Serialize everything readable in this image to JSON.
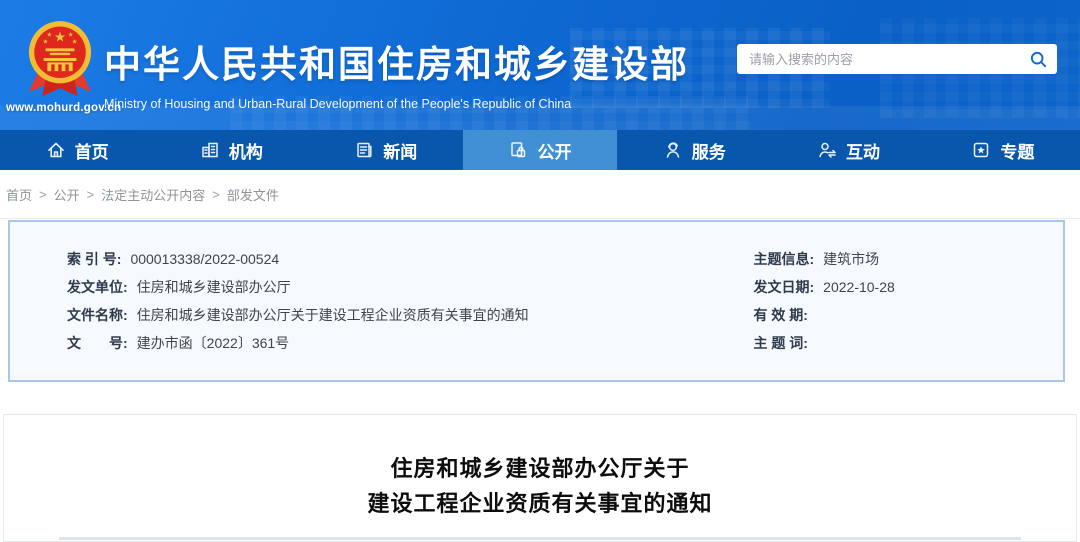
{
  "header": {
    "url_text": "www.mohurd.gov.cn",
    "site_name": "中华人民共和国住房和城乡建设部",
    "site_name_en": "Ministry of Housing and Urban-Rural Development of the People's Republic of China",
    "search": {
      "placeholder": "请输入搜索的内容",
      "icon": "search-icon"
    }
  },
  "nav": {
    "items": [
      {
        "label": "首页",
        "icon": "home-icon",
        "active": false
      },
      {
        "label": "机构",
        "icon": "organization-icon",
        "active": false
      },
      {
        "label": "新闻",
        "icon": "news-icon",
        "active": false
      },
      {
        "label": "公开",
        "icon": "disclosure-icon",
        "active": true
      },
      {
        "label": "服务",
        "icon": "service-icon",
        "active": false
      },
      {
        "label": "互动",
        "icon": "interaction-icon",
        "active": false
      },
      {
        "label": "专题",
        "icon": "topics-icon",
        "active": false
      }
    ]
  },
  "breadcrumb": {
    "separator": ">",
    "items": [
      "首页",
      "公开",
      "法定主动公开内容",
      "部发文件"
    ]
  },
  "doc_info": {
    "left": [
      {
        "label": "索 引 号:",
        "value": "000013338/2022-00524"
      },
      {
        "label": "发文单位:",
        "value": "住房和城乡建设部办公厅"
      },
      {
        "label": "文件名称:",
        "value": "住房和城乡建设部办公厅关于建设工程企业资质有关事宜的通知"
      },
      {
        "label": "文　　号:",
        "value": "建办市函〔2022〕361号"
      }
    ],
    "right": [
      {
        "label": "主题信息:",
        "value": "建筑市场"
      },
      {
        "label": "发文日期:",
        "value": "2022-10-28"
      },
      {
        "label": "有 效 期:",
        "value": ""
      },
      {
        "label": "主 题 词:",
        "value": ""
      }
    ]
  },
  "article": {
    "title_line1": "住房和城乡建设部办公厅关于",
    "title_line2": "建设工程企业资质有关事宜的通知"
  },
  "colors": {
    "header_blue": "#0f6ad4",
    "nav_blue": "#0857ac",
    "nav_active_blue": "#4190d5",
    "search_icon_blue": "#0c6ad0",
    "info_border": "#a9c6e8",
    "info_bg": "#f6f9fd"
  }
}
